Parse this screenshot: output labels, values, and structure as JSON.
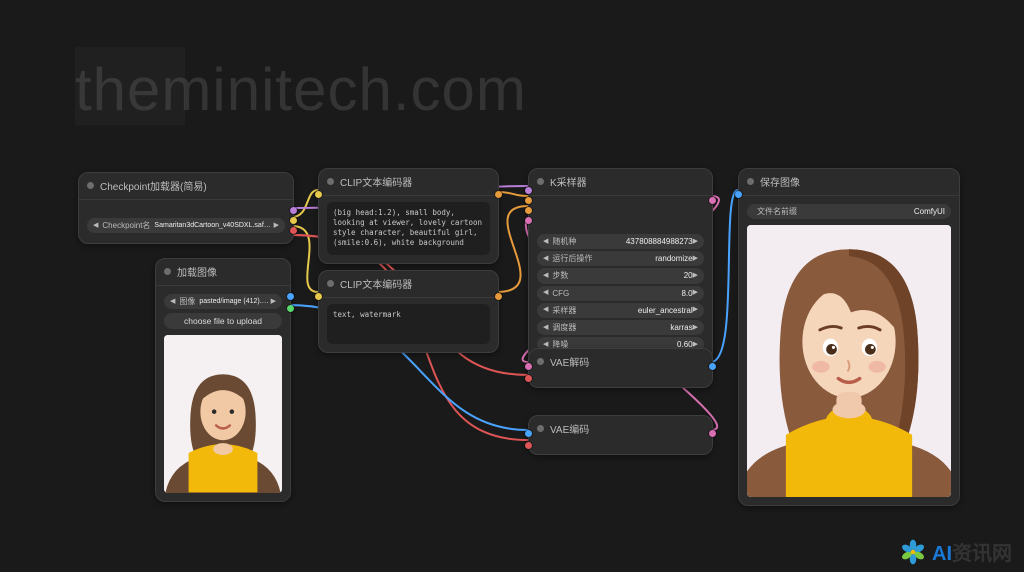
{
  "watermark": "theminitech.com",
  "nodes": {
    "checkpoint": {
      "title": "Checkpoint加载器(简易)",
      "param_label": "Checkpoint名",
      "param_value": "Samaritan3dCartoon_v40SDXL.safetensors"
    },
    "load_image": {
      "title": "加载图像",
      "file_label": "图像",
      "file_value": "pasted/image (412).png",
      "button": "choose file to upload"
    },
    "clip_pos": {
      "title": "CLIP文本编码器",
      "text": "(big head:1.2), small body, looking at viewer, lovely cartoon style character, beautiful girl, (smile:0.6), white background"
    },
    "clip_neg": {
      "title": "CLIP文本编码器",
      "text": "text, watermark"
    },
    "ksampler": {
      "title": "K采样器",
      "rows": [
        {
          "label": "随机种",
          "value": "437808884988273"
        },
        {
          "label": "运行后操作",
          "value": "randomize"
        },
        {
          "label": "步数",
          "value": "20"
        },
        {
          "label": "CFG",
          "value": "8.0"
        },
        {
          "label": "采样器",
          "value": "euler_ancestral"
        },
        {
          "label": "调度器",
          "value": "karras"
        },
        {
          "label": "降噪",
          "value": "0.60"
        }
      ]
    },
    "vae_decode": {
      "title": "VAE解码"
    },
    "vae_encode": {
      "title": "VAE编码"
    },
    "save_image": {
      "title": "保存图像",
      "prefix_label": "文件名前缀",
      "prefix_value": "ComfyUI"
    }
  },
  "brand": {
    "ai": "AI",
    "rest": "资讯网"
  }
}
